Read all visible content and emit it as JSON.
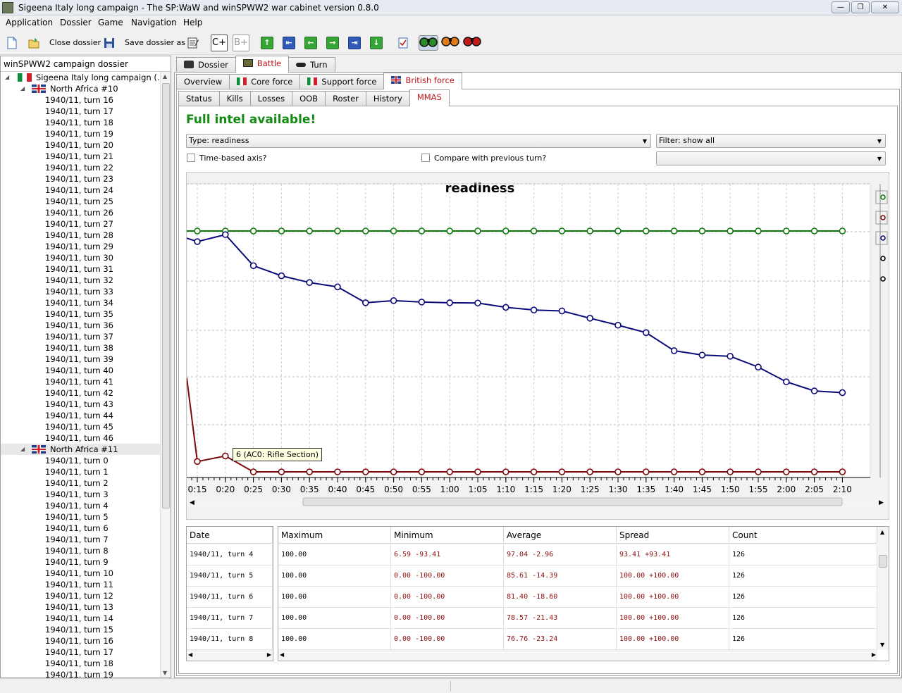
{
  "window": {
    "title": "Sigeena Italy long campaign - The SP:WaW and winSPWW2 war cabinet version 0.8.0"
  },
  "menu": [
    "Application",
    "Dossier",
    "Game",
    "Navigation",
    "Help"
  ],
  "toolbar": {
    "close_label": "Close dossier",
    "save_label": "Save dossier as",
    "c_plus": "C+",
    "b_plus": "B+"
  },
  "left_panel": {
    "header": "winSPWW2 campaign dossier",
    "campaign": "Sigeena Italy long campaign (...",
    "groups": [
      {
        "name": "North Africa #10",
        "turns": [
          "1940/11, turn 16",
          "1940/11, turn 17",
          "1940/11, turn 18",
          "1940/11, turn 19",
          "1940/11, turn 20",
          "1940/11, turn 21",
          "1940/11, turn 22",
          "1940/11, turn 23",
          "1940/11, turn 24",
          "1940/11, turn 25",
          "1940/11, turn 26",
          "1940/11, turn 27",
          "1940/11, turn 28",
          "1940/11, turn 29",
          "1940/11, turn 30",
          "1940/11, turn 31",
          "1940/11, turn 32",
          "1940/11, turn 33",
          "1940/11, turn 34",
          "1940/11, turn 35",
          "1940/11, turn 36",
          "1940/11, turn 37",
          "1940/11, turn 38",
          "1940/11, turn 39",
          "1940/11, turn 40",
          "1940/11, turn 41",
          "1940/11, turn 42",
          "1940/11, turn 43",
          "1940/11, turn 44",
          "1940/11, turn 45",
          "1940/11, turn 46"
        ]
      },
      {
        "name": "North Africa #11",
        "turns": [
          "1940/11, turn 0",
          "1940/11, turn 1",
          "1940/11, turn 2",
          "1940/11, turn 3",
          "1940/11, turn 4",
          "1940/11, turn 5",
          "1940/11, turn 6",
          "1940/11, turn 7",
          "1940/11, turn 8",
          "1940/11, turn 9",
          "1940/11, turn 10",
          "1940/11, turn 11",
          "1940/11, turn 12",
          "1940/11, turn 13",
          "1940/11, turn 14",
          "1940/11, turn 15",
          "1940/11, turn 16",
          "1940/11, turn 17",
          "1940/11, turn 18",
          "1940/11, turn 19"
        ]
      }
    ]
  },
  "tabs_top": [
    "Dossier",
    "Battle",
    "Turn"
  ],
  "tabs_force": [
    "Overview",
    "Core force",
    "Support force",
    "British force"
  ],
  "tabs_sub": [
    "Status",
    "Kills",
    "Losses",
    "OOB",
    "Roster",
    "History",
    "MMAS"
  ],
  "intel": "Full intel available!",
  "type_combo": "Type: readiness",
  "filter_combo": "Filter: show all",
  "time_axis_label": "Time-based axis?",
  "compare_label": "Compare with previous turn?",
  "tooltip": "6 (AC0: Rifle Section)",
  "chart_data": {
    "type": "line",
    "title": "readiness",
    "x": [
      "0:15",
      "0:20",
      "0:25",
      "0:30",
      "0:35",
      "0:40",
      "0:45",
      "0:50",
      "0:55",
      "1:00",
      "1:05",
      "1:10",
      "1:15",
      "1:20",
      "1:25",
      "1:30",
      "1:35",
      "1:40",
      "1:45",
      "1:50",
      "1:55",
      "2:00",
      "2:05",
      "2:10"
    ],
    "ylim": [
      0,
      100
    ],
    "grid": true,
    "colors": {
      "green": "#0a7a0a",
      "blue": "#0a0a7a",
      "red": "#7a0a0a"
    },
    "series": [
      {
        "color": "green",
        "lead_in": 100,
        "values": [
          100,
          100,
          100,
          100,
          100,
          100,
          100,
          100,
          100,
          100,
          100,
          100,
          100,
          100,
          100,
          100,
          100,
          100,
          100,
          100,
          100,
          100,
          100,
          100
        ]
      },
      {
        "color": "blue",
        "lead_in": 97.0,
        "values": [
          95.6,
          98.5,
          85.6,
          81.4,
          78.6,
          76.8,
          70.2,
          71.1,
          70.5,
          70.2,
          70.1,
          68.3,
          67.2,
          66.8,
          63.8,
          60.9,
          57.8,
          50.3,
          48.5,
          48.0,
          43.5,
          37.4,
          33.6,
          32.9
        ]
      },
      {
        "color": "red",
        "lead_in": 39.0,
        "values": [
          4.3,
          6.6,
          0,
          0,
          0,
          0,
          0,
          0,
          0,
          0,
          0,
          0,
          0,
          0,
          0,
          0,
          0,
          0,
          0,
          0,
          0,
          0,
          0,
          0
        ]
      }
    ]
  },
  "stats_table": {
    "date_header": "Date",
    "headers": [
      "Maximum",
      "Minimum",
      "Average",
      "Spread",
      "Count"
    ],
    "rows": [
      {
        "date": "1940/11, turn 4",
        "max": "100.00",
        "min": "6.59 -93.41",
        "avg": "97.04 -2.96",
        "spread": "93.41 +93.41",
        "count": "126"
      },
      {
        "date": "1940/11, turn 5",
        "max": "100.00",
        "min": "0.00 -100.00",
        "avg": "85.61 -14.39",
        "spread": "100.00 +100.00",
        "count": "126"
      },
      {
        "date": "1940/11, turn 6",
        "max": "100.00",
        "min": "0.00 -100.00",
        "avg": "81.40 -18.60",
        "spread": "100.00 +100.00",
        "count": "126"
      },
      {
        "date": "1940/11, turn 7",
        "max": "100.00",
        "min": "0.00 -100.00",
        "avg": "78.57 -21.43",
        "spread": "100.00 +100.00",
        "count": "126"
      },
      {
        "date": "1940/11, turn 8",
        "max": "100.00",
        "min": "0.00 -100.00",
        "avg": "76.76 -23.24",
        "spread": "100.00 +100.00",
        "count": "126"
      }
    ]
  }
}
